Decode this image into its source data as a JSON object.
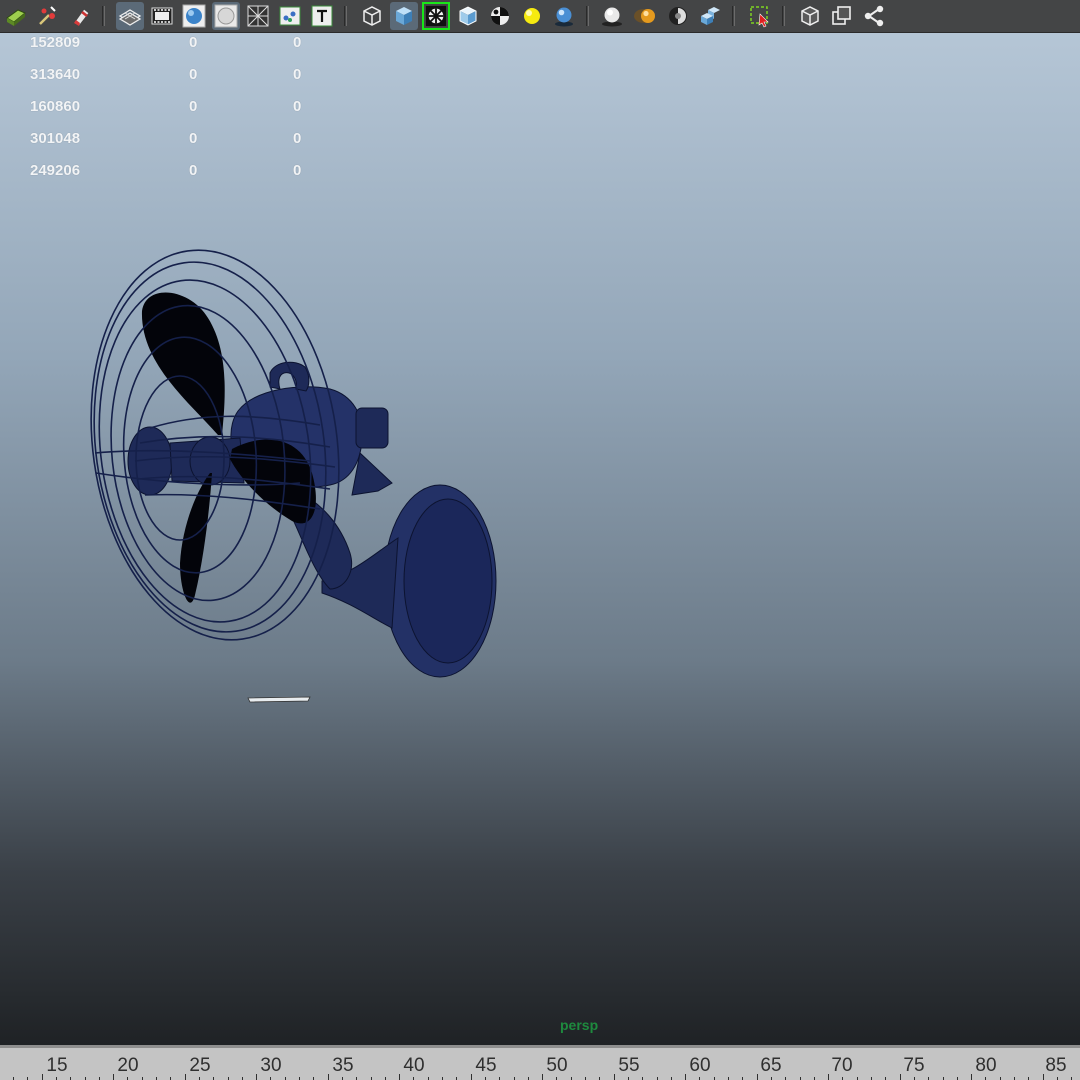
{
  "toolbar": {
    "buttons": [
      {
        "id": "make-live-icon",
        "active": false
      },
      {
        "id": "snap-together-icon",
        "active": false
      },
      {
        "id": "paint-tool-icon",
        "active": false
      },
      {
        "id": "wireframe-plane-icon",
        "active": true
      },
      {
        "id": "film-gate-icon",
        "active": false
      },
      {
        "id": "smooth-shade-icon",
        "active": false
      },
      {
        "id": "flat-shade-icon",
        "active": true
      },
      {
        "id": "grid-icon",
        "active": false
      },
      {
        "id": "uv-texture-icon",
        "active": false
      },
      {
        "id": "text-icon",
        "active": false
      },
      {
        "id": "wireframe-cube-icon",
        "active": false
      },
      {
        "id": "shaded-cube-icon",
        "active": true
      },
      {
        "id": "wireframe-on-shaded-icon",
        "active": false
      },
      {
        "id": "xray-cube-icon",
        "active": false
      },
      {
        "id": "checker-icon",
        "active": false
      },
      {
        "id": "lighting-icon",
        "active": false
      },
      {
        "id": "shadow-sphere-icon",
        "active": false
      },
      {
        "id": "ambient-occlusion-icon",
        "active": false
      },
      {
        "id": "motion-blur-icon",
        "active": false
      },
      {
        "id": "multisample-icon",
        "active": false
      },
      {
        "id": "depth-of-field-icon",
        "active": false
      },
      {
        "id": "isolate-select-icon",
        "active": false
      },
      {
        "id": "xray-toggle-icon",
        "active": false
      },
      {
        "id": "xray-joints-icon",
        "active": false
      },
      {
        "id": "component-xray-icon",
        "active": false
      }
    ]
  },
  "hud": {
    "rows": [
      [
        "152809",
        "0",
        "0"
      ],
      [
        "313640",
        "0",
        "0"
      ],
      [
        "160860",
        "0",
        "0"
      ],
      [
        "301048",
        "0",
        "0"
      ],
      [
        "249206",
        "0",
        "0"
      ]
    ]
  },
  "viewport": {
    "camera_label": "persp",
    "camera_color": "#1e8a3e",
    "model_color": "#1e2a58"
  },
  "timeslider": {
    "ticks": [
      "15",
      "20",
      "25",
      "30",
      "35",
      "40",
      "45",
      "50",
      "55",
      "60",
      "65",
      "70",
      "75",
      "80",
      "85"
    ]
  }
}
